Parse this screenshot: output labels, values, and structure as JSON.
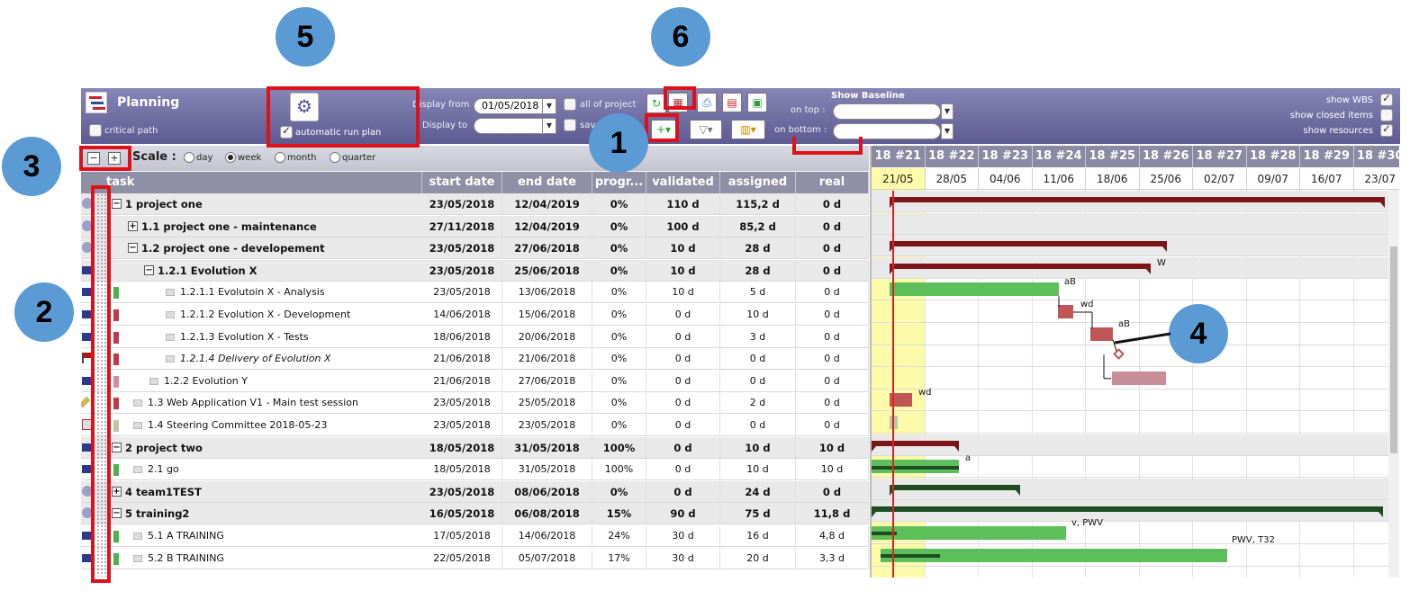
{
  "toolbar": {
    "title": "Planning",
    "critical_path": "critical path",
    "automatic_run_plan": "automatic run plan",
    "display_from_label": "Display from",
    "display_from_value": "01/05/2018",
    "display_to_label": "Display to",
    "all_of_project": "all of project",
    "save_dates": "save dates",
    "show_baseline": "Show Baseline",
    "on_top": "on top :",
    "on_bottom": "on bottom :",
    "show_wbs": "show WBS",
    "show_closed_items": "show closed items",
    "show_resources": "show resources"
  },
  "scale": {
    "label": "Scale :",
    "options": [
      "day",
      "week",
      "month",
      "quarter"
    ],
    "selected": "week"
  },
  "callouts": [
    "1",
    "2",
    "3",
    "4",
    "5",
    "6"
  ],
  "columns": [
    "task",
    "start date",
    "end date",
    "progr...",
    "validated",
    "assigned",
    "real"
  ],
  "rows": [
    {
      "name": "1 project one",
      "start": "23/05/2018",
      "end": "12/04/2019",
      "progress": "0%",
      "validated": "110 d",
      "assigned": "115,2 d",
      "real": "0 d"
    },
    {
      "name": "1.1 project one - maintenance",
      "start": "27/11/2018",
      "end": "12/04/2019",
      "progress": "0%",
      "validated": "100 d",
      "assigned": "85,2 d",
      "real": "0 d"
    },
    {
      "name": "1.2 project one - developement",
      "start": "23/05/2018",
      "end": "27/06/2018",
      "progress": "0%",
      "validated": "10 d",
      "assigned": "28 d",
      "real": "0 d"
    },
    {
      "name": "1.2.1 Evolution X",
      "start": "23/05/2018",
      "end": "25/06/2018",
      "progress": "0%",
      "validated": "10 d",
      "assigned": "28 d",
      "real": "0 d"
    },
    {
      "name": "1.2.1.1 Evolutoin X - Analysis",
      "start": "23/05/2018",
      "end": "13/06/2018",
      "progress": "0%",
      "validated": "10 d",
      "assigned": "5 d",
      "real": "0 d"
    },
    {
      "name": "1.2.1.2 Evolution X - Development",
      "start": "14/06/2018",
      "end": "15/06/2018",
      "progress": "0%",
      "validated": "0 d",
      "assigned": "10 d",
      "real": "0 d"
    },
    {
      "name": "1.2.1.3 Evolution X - Tests",
      "start": "18/06/2018",
      "end": "20/06/2018",
      "progress": "0%",
      "validated": "0 d",
      "assigned": "3 d",
      "real": "0 d"
    },
    {
      "name": "1.2.1.4 Delivery of Evolution X",
      "start": "21/06/2018",
      "end": "21/06/2018",
      "progress": "0%",
      "validated": "0 d",
      "assigned": "0 d",
      "real": "0 d"
    },
    {
      "name": "1.2.2 Evolution Y",
      "start": "21/06/2018",
      "end": "27/06/2018",
      "progress": "0%",
      "validated": "0 d",
      "assigned": "0 d",
      "real": "0 d"
    },
    {
      "name": "1.3 Web Application V1 - Main test session",
      "start": "23/05/2018",
      "end": "25/05/2018",
      "progress": "0%",
      "validated": "0 d",
      "assigned": "2 d",
      "real": "0 d"
    },
    {
      "name": "1.4 Steering Committee 2018-05-23",
      "start": "23/05/2018",
      "end": "23/05/2018",
      "progress": "0%",
      "validated": "0 d",
      "assigned": "0 d",
      "real": "0 d"
    },
    {
      "name": "2 project two",
      "start": "18/05/2018",
      "end": "31/05/2018",
      "progress": "100%",
      "validated": "0 d",
      "assigned": "10 d",
      "real": "10 d"
    },
    {
      "name": "2.1 go",
      "start": "18/05/2018",
      "end": "31/05/2018",
      "progress": "100%",
      "validated": "0 d",
      "assigned": "10 d",
      "real": "10 d"
    },
    {
      "name": "4 team1TEST",
      "start": "23/05/2018",
      "end": "08/06/2018",
      "progress": "0%",
      "validated": "0 d",
      "assigned": "24 d",
      "real": "0 d"
    },
    {
      "name": "5 training2",
      "start": "16/05/2018",
      "end": "06/08/2018",
      "progress": "15%",
      "validated": "90 d",
      "assigned": "75 d",
      "real": "11,8 d"
    },
    {
      "name": "5.1 A TRAINING",
      "start": "17/05/2018",
      "end": "14/06/2018",
      "progress": "24%",
      "validated": "30 d",
      "assigned": "16 d",
      "real": "4,8 d"
    },
    {
      "name": "5.2 B TRAINING",
      "start": "22/05/2018",
      "end": "05/07/2018",
      "progress": "17%",
      "validated": "30 d",
      "assigned": "20 d",
      "real": "3,3 d"
    }
  ],
  "gantt": {
    "weeks": [
      "18 #21",
      "18 #22",
      "18 #23",
      "18 #24",
      "18 #25",
      "18 #26",
      "18 #27",
      "18 #28",
      "18 #29",
      "18 #30"
    ],
    "dates": [
      "21/05",
      "28/05",
      "04/06",
      "11/06",
      "18/06",
      "25/06",
      "02/07",
      "09/07",
      "16/07",
      "23/07"
    ],
    "labels": [
      "W",
      "aB",
      "wd",
      "aB",
      "wd",
      "a",
      "v, PWV",
      "PWV, T32"
    ]
  },
  "colors": {
    "toolbar": "#6e6aa3",
    "header": "#8f8fa6",
    "highlight": "#e0101a",
    "callout": "#5b9bd5",
    "bar_dark_red": "#7a1518",
    "bar_green": "#5cbf5c",
    "bar_red": "#c05555",
    "bar_pink": "#c98c99",
    "bar_dark_green": "#1e4d22",
    "today_line": "#e02020",
    "today_bg": "#fdfba9"
  }
}
